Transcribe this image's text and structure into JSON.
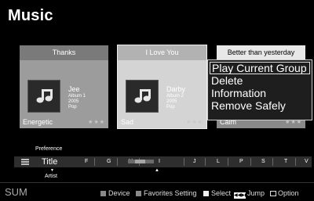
{
  "page": {
    "title": "Music"
  },
  "cards": [
    {
      "header": "Thanks",
      "artist": "Jee",
      "album": "Album 1",
      "year": "2005",
      "genre": "Pop",
      "mood": "Energetic",
      "rating_stars": "★★★"
    },
    {
      "header": "I Love You",
      "artist": "Darby",
      "album": "Album 2",
      "year": "2005",
      "genre": "Pop",
      "mood": "Sad",
      "rating_stars": "★★★"
    },
    {
      "header": "Better than yesterday",
      "mood": "Calm",
      "rating_stars": "★★★"
    }
  ],
  "context_menu": {
    "items": [
      "Play Current Group",
      "Delete",
      "Information",
      "Remove Safely"
    ],
    "selected_index": 0
  },
  "sort": {
    "above_label": "Preference",
    "current_label": "Title",
    "below_label": "Artist",
    "letters": [
      "F",
      "G",
      "H",
      "I",
      "J",
      "L",
      "P",
      "S",
      "T",
      "V"
    ]
  },
  "footer": {
    "source": "SUM",
    "device": "Device",
    "favorites_setting": "Favorites Setting",
    "select": "Select",
    "jump": "Jump",
    "option": "Option"
  }
}
